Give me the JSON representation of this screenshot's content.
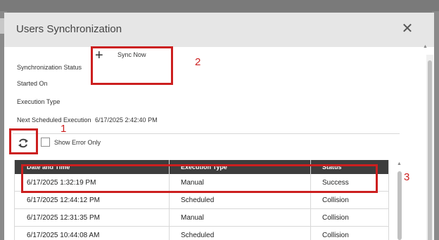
{
  "dialog": {
    "title": "Users Synchronization",
    "close_glyph": "✕"
  },
  "fields": {
    "sync_status_label": "Synchronization Status",
    "sync_now_icon": "+",
    "sync_now_label": "Sync Now",
    "started_on_label": "Started On",
    "execution_type_label": "Execution Type",
    "next_scheduled_label": "Next Scheduled Execution",
    "next_scheduled_value": "6/17/2025 2:42:40 PM"
  },
  "toolbar": {
    "refresh_icon": "refresh-icon",
    "show_error_label": "Show Error Only"
  },
  "table": {
    "columns": [
      "Date and Time",
      "Execution Type",
      "Status"
    ],
    "rows": [
      [
        "6/17/2025 1:32:19 PM",
        "Manual",
        "Success"
      ],
      [
        "6/17/2025 12:44:12 PM",
        "Scheduled",
        "Collision"
      ],
      [
        "6/17/2025 12:31:35 PM",
        "Manual",
        "Collision"
      ],
      [
        "6/17/2025 10:44:08 AM",
        "Scheduled",
        "Collision"
      ]
    ]
  },
  "annotations": [
    "1",
    "2",
    "3"
  ],
  "colors": {
    "annotation_red": "#cc1f1f",
    "table_header": "#3d3d3d",
    "modal_header": "#e6e6e6"
  }
}
